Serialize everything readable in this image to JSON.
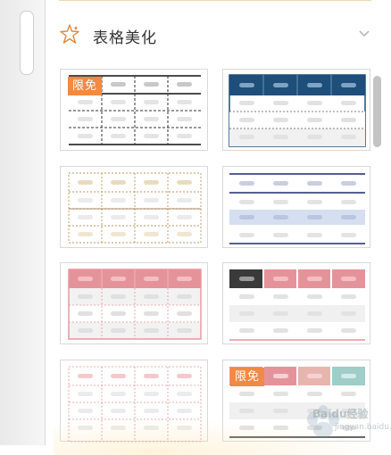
{
  "section": {
    "title": "表格美化",
    "icon": "sparkle-star-icon",
    "toggle_icon": "chevron-down-icon"
  },
  "badge_text": "限免",
  "templates": [
    {
      "name": "template-1",
      "style": "black-dashed",
      "free": true
    },
    {
      "name": "template-2",
      "style": "navy-header",
      "free": false
    },
    {
      "name": "template-3",
      "style": "beige-dotted",
      "free": false
    },
    {
      "name": "template-4",
      "style": "navy-lines-highlight",
      "free": false
    },
    {
      "name": "template-5",
      "style": "pink-header-grid",
      "free": false
    },
    {
      "name": "template-6",
      "style": "dark-pink-header",
      "free": false
    },
    {
      "name": "template-7",
      "style": "pink-dotted",
      "free": false
    },
    {
      "name": "template-8",
      "style": "pink-teal-header",
      "free": true
    }
  ],
  "colors": {
    "accent_orange": "#f08a45",
    "navy": "#1e4e7a",
    "pink": "#e5939a",
    "beige": "#b99a5a",
    "teal": "#9fcdc8"
  },
  "watermark": {
    "text": "Baidu经验",
    "sub": "jingyan.baidu.com"
  }
}
